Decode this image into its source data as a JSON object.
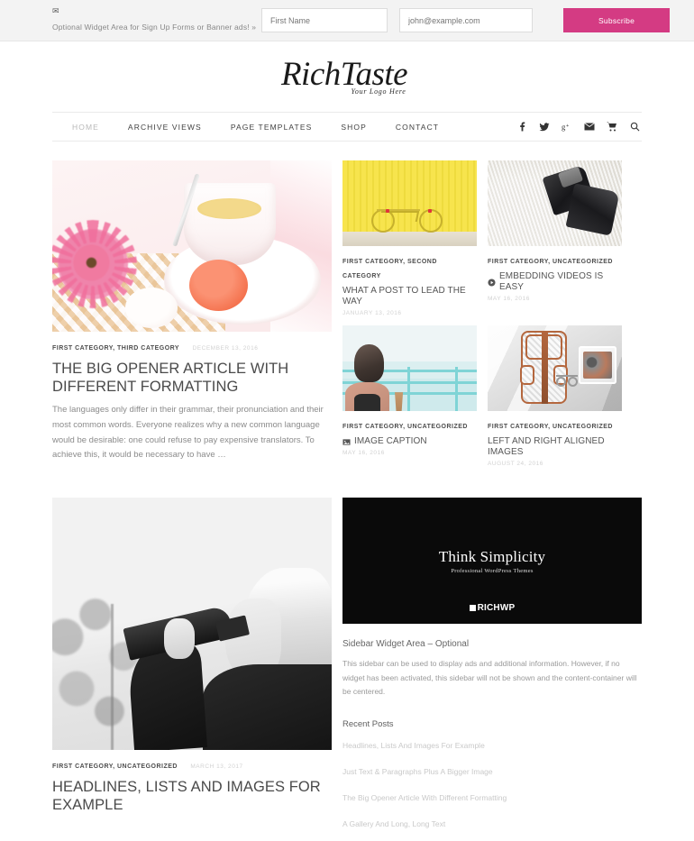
{
  "topbar": {
    "icon": "envelope-icon",
    "widget_text": "Optional Widget Area for Sign Up Forms or Banner ads! »",
    "first_name_placeholder": "First Name",
    "email_placeholder": "john@example.com",
    "subscribe_label": "Subscribe",
    "accent_color": "#d43b83"
  },
  "logo": {
    "name": "RichTaste",
    "tagline": "Your Logo Here"
  },
  "nav": {
    "items": [
      {
        "label": "HOME",
        "active": true
      },
      {
        "label": "ARCHIVE VIEWS",
        "active": false
      },
      {
        "label": "PAGE TEMPLATES",
        "active": false
      },
      {
        "label": "SHOP",
        "active": false
      },
      {
        "label": "CONTACT",
        "active": false
      }
    ],
    "social": [
      {
        "name": "facebook-icon"
      },
      {
        "name": "twitter-icon"
      },
      {
        "name": "google-plus-icon"
      },
      {
        "name": "email-icon"
      },
      {
        "name": "cart-icon"
      },
      {
        "name": "search-icon"
      }
    ]
  },
  "featured": {
    "categories": "FIRST CATEGORY, THIRD CATEGORY",
    "date": "DECEMBER 13, 2016",
    "title": "THE BIG OPENER ARTICLE WITH DIFFERENT FORMATTING",
    "excerpt": "The languages only differ in their grammar, their pronunciation and their most common words. Everyone realizes why a new common language would be desirable: one could refuse to pay expensive translators. To achieve this, it would be necessary to have …",
    "image_alt": "teacup with spoon, pink gerbera flower and orange macaron"
  },
  "grid_posts": [
    {
      "categories": "FIRST CATEGORY, SECOND CATEGORY",
      "title": "WHAT A POST TO LEAD THE WAY",
      "date": "JANUARY 13, 2016",
      "format_icon": "",
      "image_alt": "yellow corrugated wall with bicycle"
    },
    {
      "categories": "FIRST CATEGORY, UNCATEGORIZED",
      "title": "EMBEDDING VIDEOS IS EASY",
      "date": "MAY 16, 2016",
      "format_icon": "video-icon",
      "image_alt": "black shoes on white fur rug"
    },
    {
      "categories": "FIRST CATEGORY, UNCATEGORIZED",
      "title": "IMAGE CAPTION",
      "date": "MAY 16, 2016",
      "format_icon": "image-icon",
      "image_alt": "woman at ocean railing with coffee cup"
    },
    {
      "categories": "FIRST CATEGORY, UNCATEGORIZED",
      "title": "LEFT AND RIGHT ALIGNED IMAGES",
      "date": "AUGUST 24, 2016",
      "format_icon": "",
      "image_alt": "backpack and breakfast tray on bed"
    }
  ],
  "bottom_post": {
    "categories": "FIRST CATEGORY, UNCATEGORIZED",
    "date": "MARCH 13, 2017",
    "title": "HEADLINES, LISTS AND IMAGES FOR EXAMPLE",
    "image_alt": "black and white photo of blonde woman drinking from a bottle"
  },
  "sidebar": {
    "ad": {
      "title": "Think Simplicity",
      "subtitle": "Professional WordPress Themes",
      "brand": "RICHWP",
      "background_color": "#0a0a0a"
    },
    "widget_title": "Sidebar Widget Area – Optional",
    "widget_text": "This sidebar can be used to display ads and additional information. However, if no widget has been activated, this sidebar will not be shown and the content-container will be centered.",
    "recent_posts_heading": "Recent Posts",
    "recent_posts": [
      "Headlines, Lists And Images For Example",
      "Just Text & Paragraphs Plus A Bigger Image",
      "The Big Opener Article With Different Formatting",
      "A Gallery And Long, Long Text"
    ]
  }
}
